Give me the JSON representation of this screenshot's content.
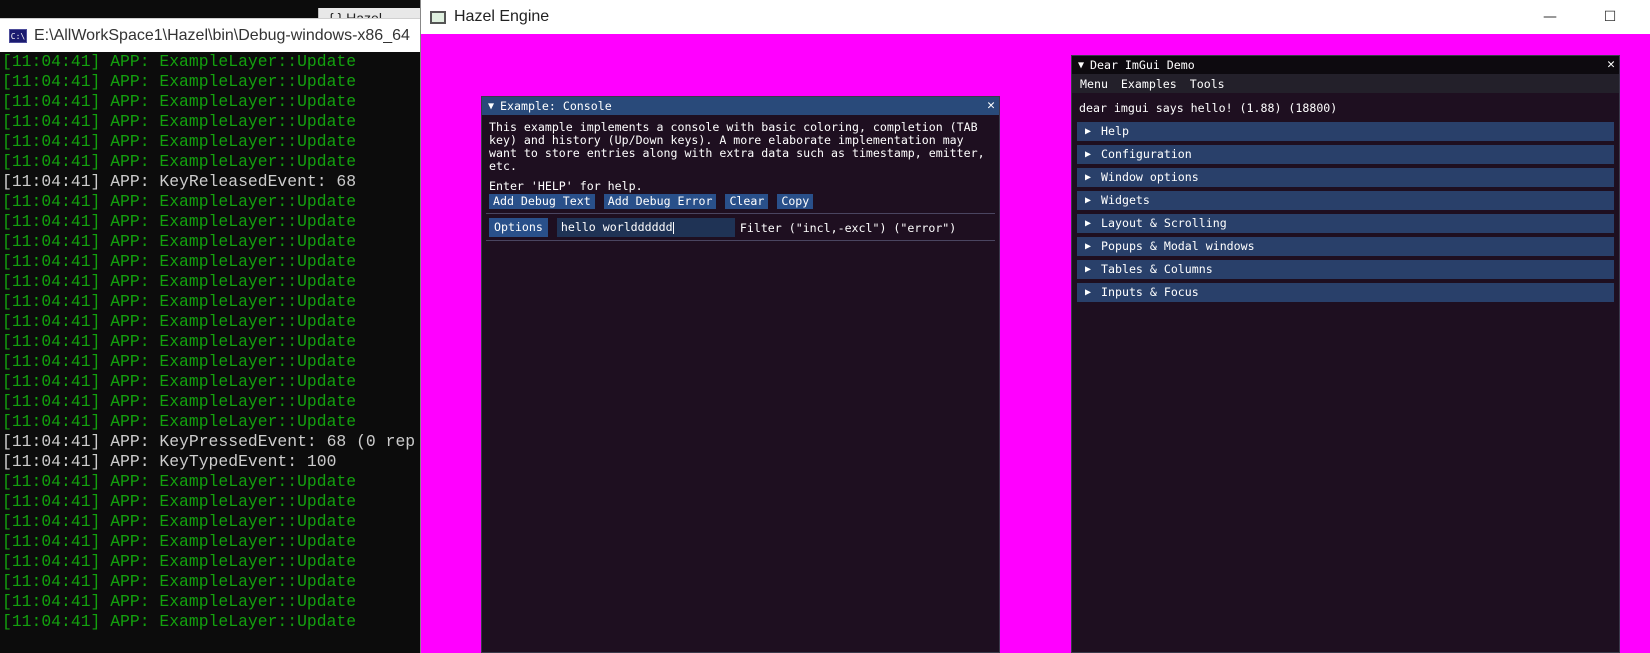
{
  "console": {
    "title": "E:\\AllWorkSpace1\\Hazel\\bin\\Debug-windows-x86_64",
    "back_tab": "{ } Hazel",
    "icon": "cmd-icon",
    "lines": [
      {
        "text": "[11:04:41] APP: ExampleLayer::Update",
        "color": "green"
      },
      {
        "text": "[11:04:41] APP: ExampleLayer::Update",
        "color": "green"
      },
      {
        "text": "[11:04:41] APP: ExampleLayer::Update",
        "color": "green"
      },
      {
        "text": "[11:04:41] APP: ExampleLayer::Update",
        "color": "green"
      },
      {
        "text": "[11:04:41] APP: ExampleLayer::Update",
        "color": "green"
      },
      {
        "text": "[11:04:41] APP: ExampleLayer::Update",
        "color": "green"
      },
      {
        "text": "[11:04:41] APP: KeyReleasedEvent: 68",
        "color": "white"
      },
      {
        "text": "[11:04:41] APP: ExampleLayer::Update",
        "color": "green"
      },
      {
        "text": "[11:04:41] APP: ExampleLayer::Update",
        "color": "green"
      },
      {
        "text": "[11:04:41] APP: ExampleLayer::Update",
        "color": "green"
      },
      {
        "text": "[11:04:41] APP: ExampleLayer::Update",
        "color": "green"
      },
      {
        "text": "[11:04:41] APP: ExampleLayer::Update",
        "color": "green"
      },
      {
        "text": "[11:04:41] APP: ExampleLayer::Update",
        "color": "green"
      },
      {
        "text": "[11:04:41] APP: ExampleLayer::Update",
        "color": "green"
      },
      {
        "text": "[11:04:41] APP: ExampleLayer::Update",
        "color": "green"
      },
      {
        "text": "[11:04:41] APP: ExampleLayer::Update",
        "color": "green"
      },
      {
        "text": "[11:04:41] APP: ExampleLayer::Update",
        "color": "green"
      },
      {
        "text": "[11:04:41] APP: ExampleLayer::Update",
        "color": "green"
      },
      {
        "text": "[11:04:41] APP: ExampleLayer::Update",
        "color": "green"
      },
      {
        "text": "[11:04:41] APP: KeyPressedEvent: 68 (0 rep",
        "color": "white"
      },
      {
        "text": "[11:04:41] APP: KeyTypedEvent: 100",
        "color": "white"
      },
      {
        "text": "[11:04:41] APP: ExampleLayer::Update",
        "color": "green"
      },
      {
        "text": "[11:04:41] APP: ExampleLayer::Update",
        "color": "green"
      },
      {
        "text": "[11:04:41] APP: ExampleLayer::Update",
        "color": "green"
      },
      {
        "text": "[11:04:41] APP: ExampleLayer::Update",
        "color": "green"
      },
      {
        "text": "[11:04:41] APP: ExampleLayer::Update",
        "color": "green"
      },
      {
        "text": "[11:04:41] APP: ExampleLayer::Update",
        "color": "green"
      },
      {
        "text": "[11:04:41] APP: ExampleLayer::Update",
        "color": "green"
      },
      {
        "text": "[11:04:41] APP: ExampleLayer::Update",
        "color": "green"
      }
    ],
    "colors": {
      "green": "#13a10e",
      "white": "#cccccc",
      "background": "#0c0c0c"
    }
  },
  "hazel": {
    "title": "Hazel Engine",
    "minimize_glyph": "—",
    "maximize_glyph": "☐",
    "background": "#ff00ff"
  },
  "imgui_console": {
    "title": "Example: Console",
    "close_glyph": "✕",
    "description": "This example implements a console with basic coloring, completion (TAB key) and history (Up/Down keys). A more elaborate implementation may want to store entries along with extra data such as timestamp, emitter, etc.",
    "help": "Enter 'HELP' for help.",
    "buttons": [
      "Add Debug Text",
      "Add Debug Error",
      "Clear",
      "Copy"
    ],
    "options_label": "Options",
    "input_value": "hello worldddddd",
    "filter_label": "Filter (\"incl,-excl\") (\"error\")"
  },
  "imgui_demo": {
    "title": "Dear ImGui Demo",
    "close_glyph": "✕",
    "menu": [
      "Menu",
      "Examples",
      "Tools"
    ],
    "hello": "dear imgui says hello! (1.88) (18800)",
    "sections": [
      "Help",
      "Configuration",
      "Window options",
      "Widgets",
      "Layout & Scrolling",
      "Popups & Modal windows",
      "Tables & Columns",
      "Inputs & Focus"
    ]
  }
}
